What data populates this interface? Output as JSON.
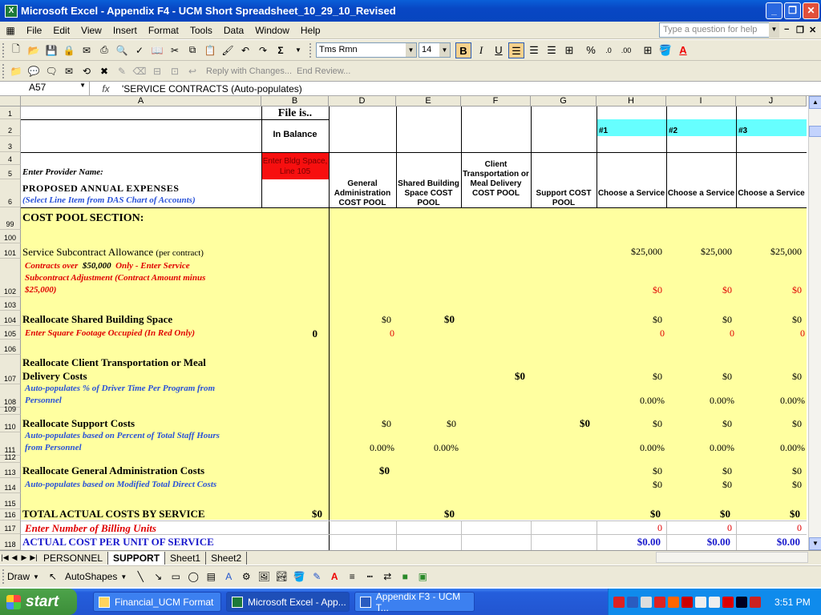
{
  "window": {
    "title": "Microsoft Excel - Appendix F4 - UCM Short Spreadsheet_10_29_10_Revised"
  },
  "menu": {
    "items": [
      "File",
      "Edit",
      "View",
      "Insert",
      "Format",
      "Tools",
      "Data",
      "Window",
      "Help"
    ],
    "ask_placeholder": "Type a question for help"
  },
  "format_toolbar": {
    "font": "Tms Rmn",
    "size": "14"
  },
  "review_toolbar": {
    "reply": "Reply with Changes...",
    "end_review": "End Review..."
  },
  "formula_bar": {
    "name_box": "A57",
    "fx": "fx",
    "formula": "'SERVICE CONTRACTS (Auto-populates)"
  },
  "columns": [
    "A",
    "B",
    "D",
    "E",
    "F",
    "G",
    "H",
    "I",
    "J"
  ],
  "rows": [
    "1",
    "2",
    "3",
    "4",
    "5",
    "6",
    "99",
    "100",
    "101",
    "102",
    "103",
    "104",
    "105",
    "106",
    "107",
    "108",
    "109",
    "110",
    "111",
    "112",
    "113",
    "114",
    "115",
    "116",
    "117",
    "118"
  ],
  "header": {
    "file_is": "File is..",
    "in_balance": "In Balance",
    "enter_bldg": "Enter Bldg Space, Line 105",
    "enter_provider": "Enter Provider Name:",
    "proposed": "PROPOSED ANNUAL EXPENSES",
    "select_line": "(Select Line Item from DAS Chart of Accounts)",
    "col_d": "General Administration COST POOL",
    "col_e": "Shared Building Space COST POOL",
    "col_f": "Client Transportation or Meal Delivery COST POOL",
    "col_g": "Support COST POOL",
    "col_h": "Choose a Service",
    "col_i": "Choose a Service",
    "col_j": "Choose a Service",
    "svc1": "#1",
    "svc2": "#2",
    "svc3": "#3"
  },
  "body": {
    "cost_pool": "COST POOL SECTION:",
    "subcontract": "Service Subcontract Allowance",
    "per_contract": "(per contract)",
    "contracts_over": "Contracts over",
    "contracts_amt": "$50,000",
    "contracts_only": "Only - Enter Service",
    "subcontract_adj": "Subcontract Adjustment (Contract Amount minus",
    "amt_25k": "$25,000)",
    "realloc_shared": "Reallocate Shared Building Space",
    "enter_sqft": "Enter Square Footage Occupied (In Red Only)",
    "realloc_client": "Reallocate Client Transportation or Meal",
    "delivery_costs": "Delivery Costs",
    "auto_driver": "Auto-populates % of Driver Time Per Program from",
    "personnel": "Personnel",
    "realloc_support": "Reallocate Support Costs",
    "auto_staff": "Auto-populates based on Percent of Total Staff Hours",
    "from_personnel": "from Personnel",
    "realloc_ga": "Reallocate General Administration Costs",
    "auto_mtdc": "Auto-populates based on Modified Total Direct Costs",
    "total_actual": "TOTAL ACTUAL COSTS BY SERVICE",
    "enter_billing": "Enter Number of Billing Units",
    "actual_cost": "ACTUAL COST PER UNIT OF SERVICE"
  },
  "values": {
    "r101": "$25,000",
    "r102": "$0",
    "r104_d": "$0",
    "r104_e": "$0",
    "r104_h": "$0",
    "r105_b": "0",
    "r105_d": "0",
    "r105_h": "0",
    "r107_f": "$0",
    "r107_h": "$0",
    "r108": "0.00%",
    "r110_d": "$0",
    "r110_e": "$0",
    "r110_g": "$0",
    "r110_h": "$0",
    "r111_d": "0.00%",
    "r111_e": "0.00%",
    "r111_h": "0.00%",
    "r113_d": "$0",
    "r113_h": "$0",
    "r114_h": "$0",
    "r116_b": "$0",
    "r116_e": "$0",
    "r116_h": "$0",
    "r117": "0",
    "r118": "$0.00"
  },
  "sheets": {
    "tabs": [
      "PERSONNEL",
      "SUPPORT",
      "Sheet1",
      "Sheet2"
    ]
  },
  "drawbar": {
    "draw": "Draw",
    "autoshapes": "AutoShapes"
  },
  "taskbar": {
    "start": "start",
    "tasks": [
      "Financial_UCM Format",
      "Microsoft Excel - App...",
      "Appendix F3 - UCM T..."
    ],
    "clock": "3:51 PM"
  }
}
